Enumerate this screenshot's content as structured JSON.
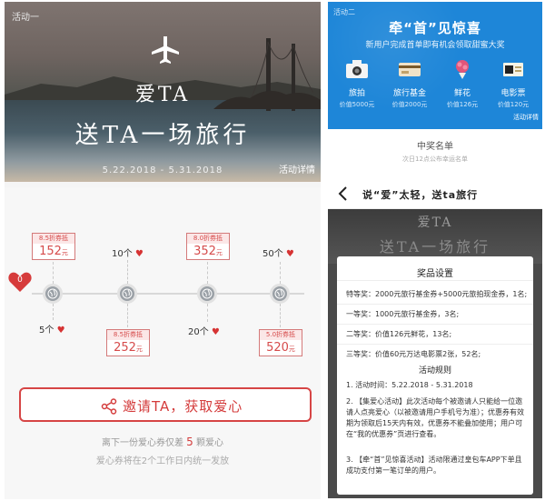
{
  "hero": {
    "tag": "活动一",
    "title_small": "爱TA",
    "title_big": "送TA一场旅行",
    "dates": "5.22.2018 - 5.31.2018",
    "detail_link": "活动详情"
  },
  "timeline": {
    "start_count": "0",
    "coupons": [
      {
        "top_label": "8.5折券抵",
        "amount": "152",
        "unit": "元"
      },
      {
        "top_label": "8.5折券抵",
        "amount": "252",
        "unit": "元"
      },
      {
        "top_label": "8.0折券抵",
        "amount": "352",
        "unit": "元"
      },
      {
        "top_label": "5.0折券抵",
        "amount": "520",
        "unit": "元"
      }
    ],
    "counts": [
      "5个",
      "10个",
      "20个",
      "50个"
    ]
  },
  "invite": {
    "button_label": "邀请TA，获取爱心",
    "progress_prefix": "离下一份爱心券仅差",
    "progress_count": "5",
    "progress_suffix": "颗爱心",
    "issue_note": "爱心券将在2个工作日内统一发放"
  },
  "promo": {
    "tag": "活动二",
    "title": "牵“首”见惊喜",
    "subtitle": "新用户完成首单即有机会领取甜蜜大奖",
    "prizes": [
      {
        "name": "旅拍",
        "value": "价值5000元",
        "icon": "camera-icon"
      },
      {
        "name": "旅行基金",
        "value": "价值2000元",
        "icon": "card-icon"
      },
      {
        "name": "鲜花",
        "value": "价值126元",
        "icon": "flower-icon"
      },
      {
        "name": "电影票",
        "value": "价值120元",
        "icon": "ticket-icon"
      }
    ],
    "detail_link": "活动详情",
    "winners_title": "中奖名单",
    "winners_sub": "次日12点公布幸运名单"
  },
  "rules_page": {
    "nav_title": "说“爱”太轻，送ta旅行",
    "bg_title_small": "爱TA",
    "bg_title_big": "送TA一场旅行"
  },
  "modal": {
    "prize_heading": "奖品设置",
    "prizes": [
      "特等奖：2000元旅行基金券+5000元旅拍现金券，1名;",
      "一等奖：1000元旅行基金券，3名;",
      "二等奖：价值126元鲜花，13名;",
      "三等奖：价值60元万达电影票2张，52名;"
    ],
    "rules_heading": "活动规则",
    "rules": [
      "1. 活动时间：5.22.2018 - 5.31.2018",
      "2. 【集爱心活动】此次活动每个被邀请人只能给一位邀请人点亮爱心（以被邀请用户手机号为准）；优惠券有效期为领取后15天内有效，优惠券不能叠加使用；用户可在“我的优惠券”页进行查看。",
      "3. 【牵“首”见惊喜活动】活动限通过皇包车APP下单且成功支付第一笔订单的用户。"
    ]
  },
  "colors": {
    "accent_red": "#d43c3c",
    "promo_blue": "#1e86d8"
  }
}
